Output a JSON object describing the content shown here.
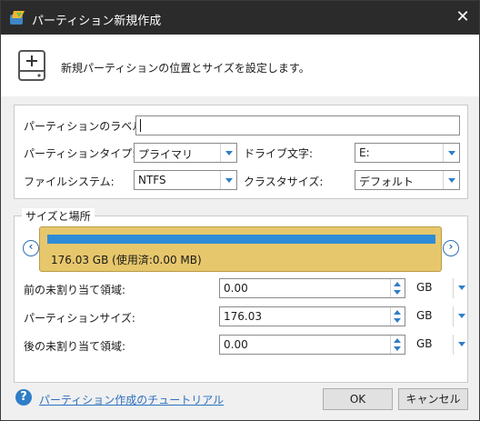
{
  "window": {
    "title": "パーティション新規作成",
    "close_glyph": "✕"
  },
  "header": {
    "description": "新規パーティションの位置とサイズを設定します。"
  },
  "form": {
    "label_caption": "パーティションのラベル:",
    "label_value": "",
    "type_caption": "パーティションタイプ:",
    "type_value": "プライマリ",
    "drive_caption": "ドライブ文字:",
    "drive_value": "E:",
    "fs_caption": "ファイルシステム:",
    "fs_value": "NTFS",
    "cluster_caption": "クラスタサイズ:",
    "cluster_value": "デフォルト"
  },
  "size_location": {
    "group_title": "サイズと場所",
    "partition_summary": "176.03 GB (使用済:0.00 MB)",
    "nav_left": "‹",
    "nav_right": "›",
    "rows": [
      {
        "caption": "前の未割り当て領域:",
        "value": "0.00",
        "unit": "GB"
      },
      {
        "caption": "パーティションサイズ:",
        "value": "176.03",
        "unit": "GB"
      },
      {
        "caption": "後の未割り当て領域:",
        "value": "0.00",
        "unit": "GB"
      }
    ]
  },
  "footer": {
    "help_glyph": "?",
    "tutorial_link": "パーティション作成のチュートリアル",
    "ok_label": "OK",
    "cancel_label": "キャンセル"
  },
  "colors": {
    "partition_fill": "#2f8bd6",
    "partition_bg": "#e7c76b",
    "accent": "#2f7ec8"
  }
}
